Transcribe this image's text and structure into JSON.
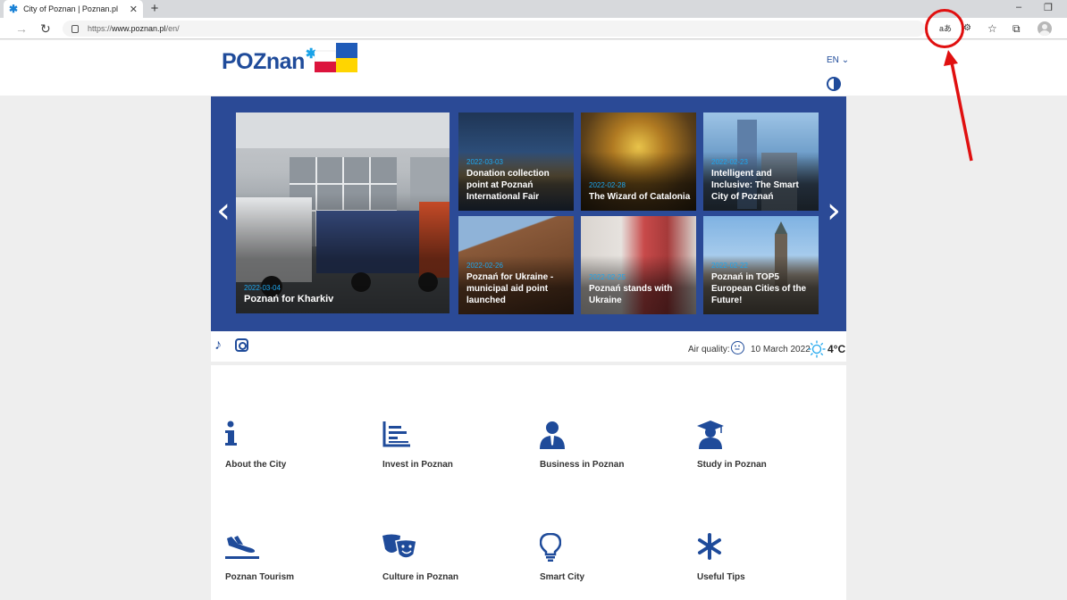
{
  "browser": {
    "tab_title": "City of Poznan | Poznan.pl",
    "tab_close": "✕",
    "new_tab": "+",
    "url_prefix": "https://",
    "url_host": "www.poznan.pl",
    "url_path": "/en/",
    "toolbar_icons": [
      "back-icon",
      "refresh-icon",
      "translate-icon",
      "extension-icon",
      "favorites-icon",
      "collections-icon",
      "profile-icon"
    ],
    "translate_label": "aあ"
  },
  "annotation": {
    "color": "#e01010"
  },
  "header": {
    "logo_text": "POZnan",
    "language": "EN",
    "brand_color": "#1f4b9a"
  },
  "slider": {
    "prev": "‹",
    "next": "›",
    "big_card": {
      "date": "2022-03-04",
      "title": "Poznań for Kharkiv"
    },
    "cards": [
      {
        "date": "2022-03-03",
        "title": "Donation collection point at Poznań International Fair"
      },
      {
        "date": "2022-02-28",
        "title": "The Wizard of Catalonia"
      },
      {
        "date": "2022-02-23",
        "title": "Intelligent and Inclusive: The Smart City of Poznań"
      },
      {
        "date": "2022-02-26",
        "title": "Poznań for Ukraine - municipal aid point launched"
      },
      {
        "date": "2022-02-25",
        "title": "Poznań stands with Ukraine"
      },
      {
        "date": "2022-02-22",
        "title": "Poznań in TOP5 European Cities of the Future!"
      }
    ]
  },
  "infobar": {
    "air_quality_label": "Air quality:",
    "date": "10 March 2022",
    "temperature": "4°C"
  },
  "tiles": [
    {
      "label": "About the City",
      "icon": "info-icon"
    },
    {
      "label": "Invest in Poznan",
      "icon": "chart-icon"
    },
    {
      "label": "Business in Poznan",
      "icon": "businessman-icon"
    },
    {
      "label": "Study in Poznan",
      "icon": "graduate-icon"
    },
    {
      "label": "Poznan Tourism",
      "icon": "plane-icon"
    },
    {
      "label": "Culture in Poznan",
      "icon": "theater-masks-icon"
    },
    {
      "label": "Smart City",
      "icon": "lightbulb-icon"
    },
    {
      "label": "Useful Tips",
      "icon": "asterisk-icon"
    }
  ]
}
